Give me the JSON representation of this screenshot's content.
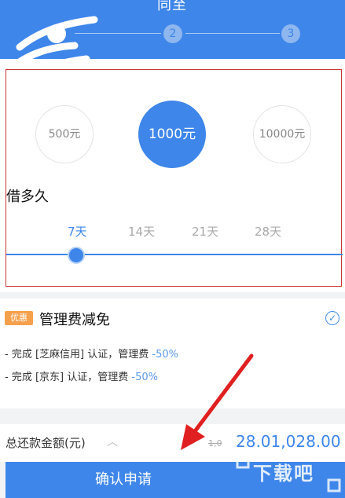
{
  "header": {
    "title": "同至",
    "steps": [
      {
        "label": "",
        "active": true
      },
      {
        "label": "2",
        "active": false
      },
      {
        "label": "3",
        "active": false
      }
    ]
  },
  "amounts": {
    "options": [
      "500元",
      "1000元",
      "10000元"
    ],
    "selected": "1000元"
  },
  "duration": {
    "title": "借多久",
    "options": [
      "7天",
      "14天",
      "21天",
      "28天"
    ],
    "selected": "7天"
  },
  "discount": {
    "tag": "优惠",
    "title": "管理费减免",
    "lines": [
      {
        "text": "- 完成 [芝麻信用] 认证，管理费",
        "pct": "-50%"
      },
      {
        "text": "- 完成 [京东] 认证，管理费",
        "pct": "-50%"
      }
    ]
  },
  "summary": {
    "label": "总还款金额(元)",
    "old_value": "1,0",
    "value": "28.01,028.00"
  },
  "confirm": {
    "label": "确认申请"
  },
  "watermark": {
    "text": "下载吧"
  },
  "colors": {
    "primary": "#3e86ea",
    "tag": "#f6a04d",
    "annotation": "#e02020"
  }
}
